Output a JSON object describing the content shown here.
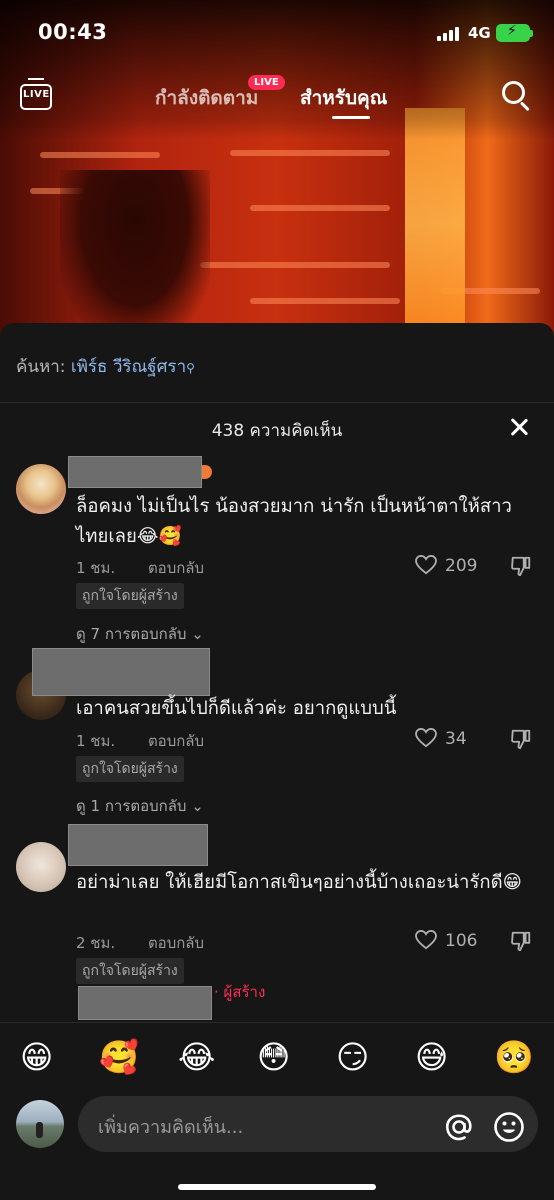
{
  "status_bar": {
    "time": "00:43",
    "network": "4G"
  },
  "top_nav": {
    "live_icon_label": "LIVE",
    "following_tab": "กำลังติดตาม",
    "live_badge": "LIVE",
    "for_you_tab": "สำหรับคุณ"
  },
  "search_suggestion": {
    "prefix": "ค้นหา:",
    "term": "เพิร์ธ วีริณฐ์ศรา"
  },
  "comments_header": {
    "count_label": "438 ความคิดเห็น"
  },
  "comments": [
    {
      "text": "ล็อคมง ไม่เป็นไร น้องสวยมาก น่ารัก เป็นหน้าตาให้สาวไทยเลย😂🥰",
      "time": "1 ชม.",
      "reply_label": "ตอบกลับ",
      "creator_liked": "ถูกใจโดยผู้สร้าง",
      "likes": "209",
      "view_replies": "ดู 7 การตอบกลับ"
    },
    {
      "text": "เอาคนสวยขึ้นไปก็ดีแล้วค่ะ  อยากดูแบบนี้",
      "time": "1 ชม.",
      "reply_label": "ตอบกลับ",
      "creator_liked": "ถูกใจโดยผู้สร้าง",
      "likes": "34",
      "view_replies": "ดู 1 การตอบกลับ"
    },
    {
      "text": "อย่าม่าเลย ให้เฮียมีโอกาสเขินๆอย่างนี้บ้างเถอะน่ารักดี😁",
      "time": "2 ชม.",
      "reply_label": "ตอบกลับ",
      "creator_liked": "ถูกใจโดยผู้สร้าง",
      "likes": "106"
    }
  ],
  "creator_reply_tag": "· ผู้สร้าง",
  "emoji_bar": [
    "😁",
    "🥰",
    "😂",
    "😳",
    "😏",
    "😅",
    "🥺"
  ],
  "input": {
    "placeholder": "เพิ่มความคิดเห็น..."
  },
  "colors": {
    "accent": "#fe2c55",
    "sheet_bg": "#161616",
    "link": "#8fb8ea"
  },
  "icons": [
    "live-tv-icon",
    "search-icon",
    "close-icon",
    "heart-icon",
    "dislike-icon",
    "chevron-down-icon",
    "at-icon",
    "emoji-icon"
  ]
}
